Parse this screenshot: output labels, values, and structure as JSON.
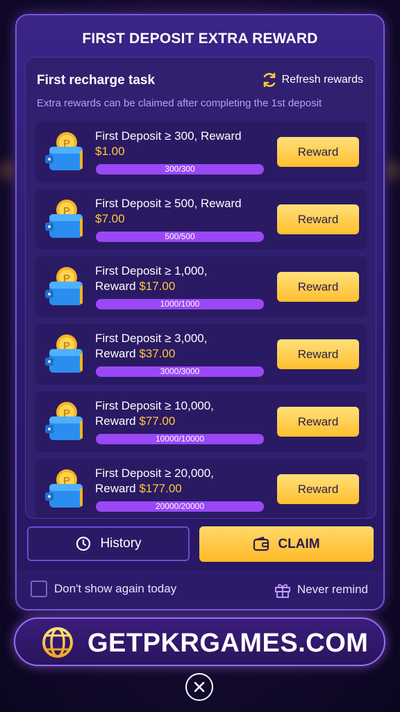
{
  "modal": {
    "title": "FIRST DEPOSIT EXTRA REWARD",
    "panel_title": "First recharge task",
    "refresh_label": "Refresh rewards",
    "subtitle": "Extra rewards can be claimed after completing the 1st deposit"
  },
  "tasks": [
    {
      "line1": "First Deposit ≥ 300, Reward",
      "line2_prefix": "",
      "amount": "$1.00",
      "progress_text": "300/300",
      "progress": 1.0,
      "button": "Reward"
    },
    {
      "line1": "First Deposit ≥ 500, Reward",
      "line2_prefix": "",
      "amount": "$7.00",
      "progress_text": "500/500",
      "progress": 1.0,
      "button": "Reward"
    },
    {
      "line1": "First Deposit ≥ 1,000,",
      "line2_prefix": "Reward ",
      "amount": "$17.00",
      "progress_text": "1000/1000",
      "progress": 1.0,
      "button": "Reward"
    },
    {
      "line1": "First Deposit ≥ 3,000,",
      "line2_prefix": "Reward ",
      "amount": "$37.00",
      "progress_text": "3000/3000",
      "progress": 1.0,
      "button": "Reward"
    },
    {
      "line1": "First Deposit ≥ 10,000,",
      "line2_prefix": "Reward ",
      "amount": "$77.00",
      "progress_text": "10000/10000",
      "progress": 1.0,
      "button": "Reward"
    },
    {
      "line1": "First Deposit ≥ 20,000,",
      "line2_prefix": "Reward ",
      "amount": "$177.00",
      "progress_text": "20000/20000",
      "progress": 1.0,
      "button": "Reward"
    }
  ],
  "actions": {
    "history_label": "History",
    "claim_label": "CLAIM"
  },
  "footer": {
    "dont_show_label": "Don't show again today",
    "dont_show_checked": false,
    "never_remind_label": "Never remind"
  },
  "banner": {
    "text": "GETPKRGAMES.COM"
  },
  "icons": {
    "refresh": "refresh-icon",
    "wallet": "wallet-coin-icon",
    "history": "clock-icon",
    "claim": "wallet-icon",
    "gift": "gift-icon",
    "globe": "globe-icon",
    "close": "close-icon"
  },
  "colors": {
    "accent": "#ffc93a",
    "progress": "#9a48f5",
    "panel": "#30206f"
  }
}
